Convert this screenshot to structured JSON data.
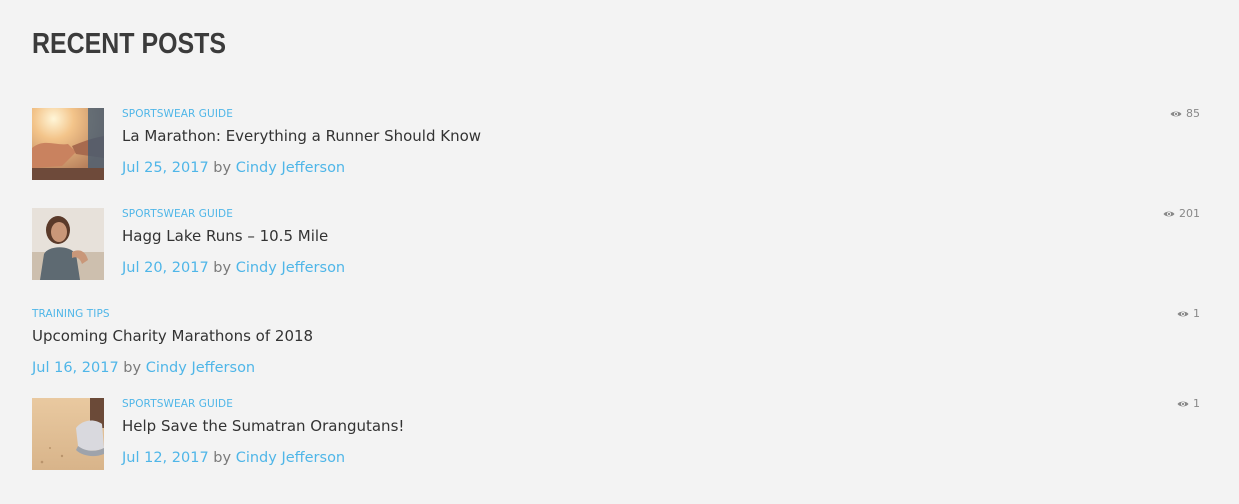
{
  "widget": {
    "title": "RECENT POSTS"
  },
  "posts": [
    {
      "category": "SPORTSWEAR GUIDE",
      "title": "La Marathon: Everything a Runner Should Know",
      "date": "Jul 25, 2017",
      "by": "by",
      "author": "Cindy Jefferson",
      "views": "85",
      "thumbnail": "runners-handshake"
    },
    {
      "category": "SPORTSWEAR GUIDE",
      "title": "Hagg Lake Runs – 10.5 Mile",
      "date": "Jul 20, 2017",
      "by": "by",
      "author": "Cindy Jefferson",
      "views": "201",
      "thumbnail": "woman-running"
    },
    {
      "category": "TRAINING TIPS",
      "title": "Upcoming Charity Marathons of 2018",
      "date": "Jul 16, 2017",
      "by": "by",
      "author": "Cindy Jefferson",
      "views": "1"
    },
    {
      "category": "SPORTSWEAR GUIDE",
      "title": "Help Save the Sumatran Orangutans!",
      "date": "Jul 12, 2017",
      "by": "by",
      "author": "Cindy Jefferson",
      "views": "1",
      "thumbnail": "running-shoe"
    }
  ],
  "colors": {
    "accent": "#4fb6e8",
    "text": "#333333",
    "muted": "#7a7a7a",
    "background": "#f3f3f3"
  }
}
